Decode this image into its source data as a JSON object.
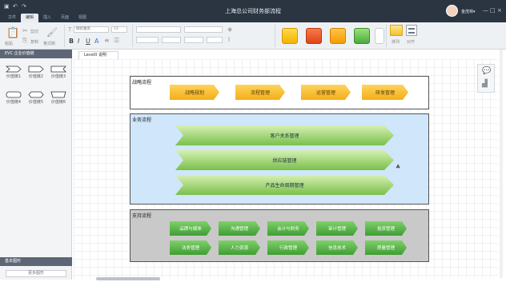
{
  "app": {
    "title": "上海总公司财务部流程",
    "user": "金茂林▾",
    "menu_tabs": [
      "文件",
      "编辑",
      "插入",
      "页面",
      "视图"
    ],
    "qa_icons": [
      "app-icon",
      "undo-icon",
      "redo-icon"
    ],
    "win_controls": [
      "—",
      "□",
      "×"
    ]
  },
  "ribbon": {
    "paste": "粘贴",
    "cut": "剪切",
    "copy": "复制",
    "format_painter": "格式刷",
    "font_select": "微软雅黑",
    "size_select": "13",
    "bold": "B",
    "italic": "I",
    "underline": "U",
    "font_color": "A",
    "arrange": "排列",
    "align": "对齐",
    "style_colors": [
      "#f5c000",
      "#e3501f",
      "#f8a700",
      "#57b64a",
      "#ffffff"
    ]
  },
  "sidebar": {
    "header": "EVC 企业价值链",
    "shapes": [
      "价值链1",
      "价值链2",
      "价值链3",
      "价值链4",
      "价值链5",
      "价值链6"
    ],
    "footer": "基本图形",
    "more": "更多图形"
  },
  "doc_tab": "Level0 说明",
  "lanes": {
    "strategy": {
      "title": "战略流程",
      "items": [
        "战略规划",
        "流程管理",
        "运营管理",
        "研发管理"
      ]
    },
    "business": {
      "title": "业务流程",
      "items": [
        "客户关系管理",
        "供应链管理",
        "产品生命周期管理"
      ]
    },
    "support": {
      "title": "支持流程",
      "row1": [
        "品牌与媒体",
        "沟通管理",
        "会计与财务",
        "审计管理",
        "投资管理"
      ],
      "row2": [
        "法务管理",
        "人力资源",
        "行政管理",
        "信息技术",
        "质量管理"
      ]
    }
  }
}
